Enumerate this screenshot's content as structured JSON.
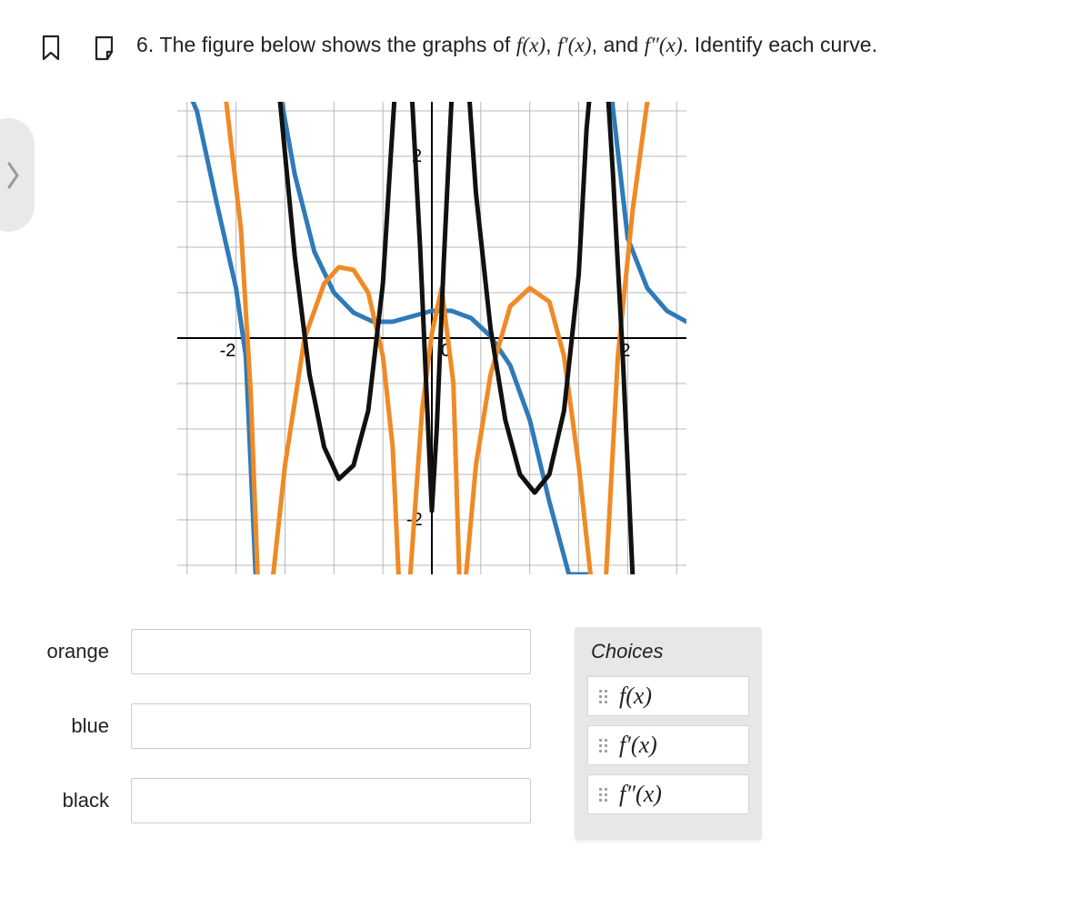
{
  "question": {
    "number": "6.",
    "prefix": "The figure below shows the graphs of",
    "fx": "f(x)",
    "fpx": "f′(x)",
    "fppx": "f″(x)",
    "suffix": ". Identify each curve."
  },
  "answers": {
    "rows": [
      {
        "label": "orange"
      },
      {
        "label": "blue"
      },
      {
        "label": "black"
      }
    ]
  },
  "choices": {
    "title": "Choices",
    "items": [
      {
        "label": "f(x)"
      },
      {
        "label": "f′(x)"
      },
      {
        "label": "f″(x)"
      }
    ]
  },
  "chart_data": {
    "type": "line",
    "xlim": [
      -2.6,
      2.6
    ],
    "ylim": [
      -2.6,
      2.6
    ],
    "x_ticks": [
      -2,
      0,
      2
    ],
    "y_ticks": [
      -2,
      0,
      2
    ],
    "axis_labels": {
      "x_tick_labels": [
        "-2",
        "0",
        "2"
      ],
      "y_tick_labels": [
        "-2",
        "2"
      ]
    },
    "series": [
      {
        "name": "blue",
        "color": "#2f7ab8",
        "asymptotes_x": [
          -1.707,
          1.707
        ],
        "points": [
          [
            -2.6,
            3.0
          ],
          [
            -2.4,
            2.5
          ],
          [
            -2.2,
            1.5
          ],
          [
            -2.0,
            0.55
          ],
          [
            -1.9,
            -0.2
          ],
          [
            -1.8,
            -2.6
          ],
          [
            -1.6,
            3.0
          ],
          [
            -1.4,
            1.8
          ],
          [
            -1.2,
            0.95
          ],
          [
            -1.0,
            0.5
          ],
          [
            -0.8,
            0.28
          ],
          [
            -0.6,
            0.18
          ],
          [
            -0.4,
            0.18
          ],
          [
            -0.2,
            0.24
          ],
          [
            0.0,
            0.3
          ],
          [
            0.2,
            0.3
          ],
          [
            0.4,
            0.22
          ],
          [
            0.6,
            0.02
          ],
          [
            0.8,
            -0.3
          ],
          [
            1.0,
            -0.9
          ],
          [
            1.2,
            -1.8
          ],
          [
            1.4,
            -2.6
          ],
          [
            1.6,
            -2.6
          ],
          [
            1.8,
            3.0
          ],
          [
            2.0,
            1.1
          ],
          [
            2.2,
            0.55
          ],
          [
            2.4,
            0.3
          ],
          [
            2.6,
            0.18
          ]
        ]
      },
      {
        "name": "orange",
        "color": "#f08a24",
        "asymptotes_x": [
          -1.707,
          -0.293,
          0.293,
          1.707
        ],
        "points": [
          [
            -2.6,
            3.0
          ],
          [
            -2.3,
            3.0
          ],
          [
            -2.1,
            2.6
          ],
          [
            -1.95,
            1.2
          ],
          [
            -1.85,
            -0.6
          ],
          [
            -1.78,
            -2.6
          ],
          [
            -1.62,
            -2.6
          ],
          [
            -1.5,
            -1.4
          ],
          [
            -1.3,
            0.0
          ],
          [
            -1.1,
            0.6
          ],
          [
            -0.95,
            0.78
          ],
          [
            -0.8,
            0.75
          ],
          [
            -0.65,
            0.5
          ],
          [
            -0.5,
            -0.2
          ],
          [
            -0.4,
            -1.2
          ],
          [
            -0.34,
            -2.6
          ],
          [
            -0.22,
            -2.6
          ],
          [
            -0.1,
            -0.8
          ],
          [
            0.0,
            0.05
          ],
          [
            0.1,
            0.55
          ],
          [
            0.22,
            -0.5
          ],
          [
            0.28,
            -2.6
          ],
          [
            0.35,
            -2.6
          ],
          [
            0.45,
            -1.4
          ],
          [
            0.6,
            -0.4
          ],
          [
            0.8,
            0.35
          ],
          [
            1.0,
            0.55
          ],
          [
            1.2,
            0.4
          ],
          [
            1.35,
            -0.2
          ],
          [
            1.5,
            -1.4
          ],
          [
            1.62,
            -2.6
          ],
          [
            1.78,
            -2.6
          ],
          [
            1.9,
            -0.2
          ],
          [
            2.05,
            1.4
          ],
          [
            2.2,
            2.6
          ],
          [
            2.4,
            3.0
          ],
          [
            2.6,
            3.0
          ]
        ]
      },
      {
        "name": "black",
        "color": "#111111",
        "asymptotes_x": [
          -1.707,
          -0.293,
          0.293,
          1.707
        ],
        "points": [
          [
            -1.62,
            3.0
          ],
          [
            -1.55,
            2.6
          ],
          [
            -1.4,
            0.9
          ],
          [
            -1.25,
            -0.4
          ],
          [
            -1.1,
            -1.2
          ],
          [
            -0.95,
            -1.55
          ],
          [
            -0.8,
            -1.4
          ],
          [
            -0.65,
            -0.8
          ],
          [
            -0.5,
            0.6
          ],
          [
            -0.42,
            2.0
          ],
          [
            -0.36,
            3.0
          ],
          [
            -0.22,
            3.0
          ],
          [
            -0.12,
            1.0
          ],
          [
            -0.05,
            -0.7
          ],
          [
            0.0,
            -1.9
          ],
          [
            0.05,
            -1.0
          ],
          [
            0.12,
            0.8
          ],
          [
            0.2,
            2.6
          ],
          [
            0.26,
            3.0
          ],
          [
            0.36,
            3.0
          ],
          [
            0.45,
            1.6
          ],
          [
            0.6,
            0.1
          ],
          [
            0.75,
            -0.9
          ],
          [
            0.9,
            -1.5
          ],
          [
            1.05,
            -1.7
          ],
          [
            1.2,
            -1.5
          ],
          [
            1.35,
            -0.8
          ],
          [
            1.5,
            0.7
          ],
          [
            1.58,
            2.3
          ],
          [
            1.64,
            3.0
          ],
          [
            1.78,
            3.0
          ],
          [
            1.85,
            1.8
          ],
          [
            1.95,
            -0.2
          ],
          [
            2.05,
            -2.6
          ]
        ]
      }
    ]
  }
}
